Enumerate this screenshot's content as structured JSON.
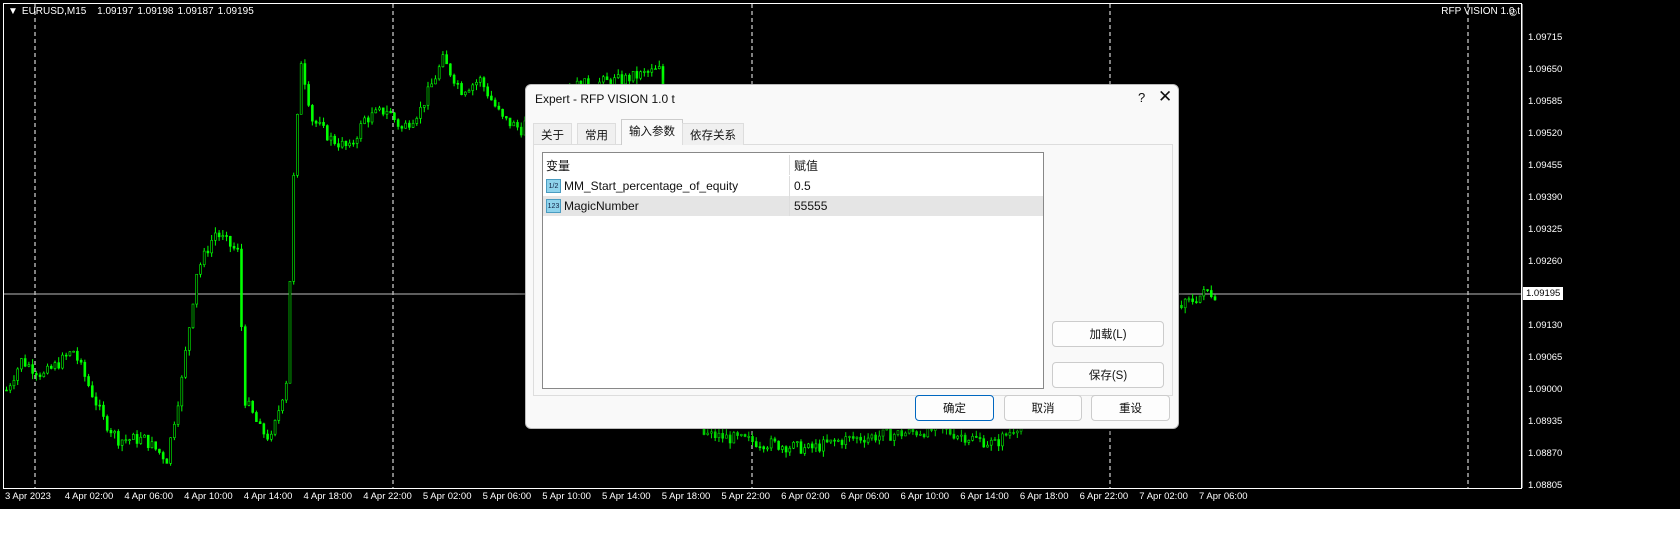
{
  "chart": {
    "symbol": "EURUSD,M15",
    "ohlc": [
      "1.09197",
      "1.09198",
      "1.09187",
      "1.09195"
    ],
    "ea_label": "RFP VISION 1.0 t",
    "current_price": "1.09195",
    "price_labels": [
      "1.09715",
      "1.09650",
      "1.09585",
      "1.09520",
      "1.09455",
      "1.09390",
      "1.09325",
      "1.09260",
      "1.09130",
      "1.09065",
      "1.09000",
      "1.08935",
      "1.08870",
      "1.08805"
    ],
    "time_labels": [
      "3 Apr 2023",
      "4 Apr 02:00",
      "4 Apr 06:00",
      "4 Apr 10:00",
      "4 Apr 14:00",
      "4 Apr 18:00",
      "4 Apr 22:00",
      "5 Apr 02:00",
      "5 Apr 06:00",
      "5 Apr 10:00",
      "5 Apr 14:00",
      "5 Apr 18:00",
      "5 Apr 22:00",
      "6 Apr 02:00",
      "6 Apr 06:00",
      "6 Apr 10:00",
      "6 Apr 14:00",
      "6 Apr 18:00",
      "6 Apr 22:00",
      "7 Apr 02:00",
      "7 Apr 06:00"
    ],
    "colors": {
      "candle": "#00ff00",
      "background": "#000000",
      "grid": "#ffffff"
    }
  },
  "chart_data": {
    "type": "candlestick",
    "title": "EURUSD,M15",
    "ylim": [
      1.08805,
      1.09715
    ],
    "price_path_keypoints": [
      [
        0,
        1.09
      ],
      [
        4,
        1.0906
      ],
      [
        10,
        1.0903
      ],
      [
        18,
        1.0908
      ],
      [
        26,
        1.0894
      ],
      [
        30,
        1.089
      ],
      [
        37,
        1.089
      ],
      [
        43,
        1.0886
      ],
      [
        47,
        1.0902
      ],
      [
        51,
        1.0924
      ],
      [
        56,
        1.0932
      ],
      [
        62,
        1.0928
      ],
      [
        64,
        1.0898
      ],
      [
        68,
        1.0892
      ],
      [
        71,
        1.089
      ],
      [
        75,
        1.0902
      ],
      [
        77,
        1.0943
      ],
      [
        79,
        1.0967
      ],
      [
        82,
        1.0955
      ],
      [
        87,
        1.0951
      ],
      [
        92,
        1.0949
      ],
      [
        96,
        1.0955
      ],
      [
        102,
        1.0957
      ],
      [
        106,
        1.0953
      ],
      [
        111,
        1.0957
      ],
      [
        117,
        1.0967
      ],
      [
        122,
        1.0961
      ],
      [
        127,
        1.0963
      ],
      [
        133,
        1.0955
      ],
      [
        138,
        1.0953
      ],
      [
        145,
        1.0961
      ],
      [
        165,
        1.0963
      ],
      [
        175,
        1.0965
      ],
      [
        187,
        1.0891
      ],
      [
        215,
        1.0888
      ],
      [
        225,
        1.089
      ],
      [
        250,
        1.0892
      ],
      [
        265,
        1.0889
      ],
      [
        290,
        1.0905
      ],
      [
        315,
        1.0917
      ],
      [
        322,
        1.092
      ],
      [
        324,
        1.09195
      ]
    ]
  },
  "dialog": {
    "title": "Expert - RFP VISION 1.0 t",
    "help": "?",
    "close": "✕",
    "tabs": [
      "关于",
      "常用",
      "输入参数",
      "依存关系"
    ],
    "columns": [
      "变量",
      "赋值"
    ],
    "params": [
      {
        "icon": "1/2",
        "name": "MM_Start_percentage_of_equity",
        "value": "0.5"
      },
      {
        "icon": "123",
        "name": "MagicNumber",
        "value": "55555"
      }
    ],
    "load": "加载(L)",
    "save": "保存(S)",
    "ok": "确定",
    "cancel": "取消",
    "reset": "重设"
  }
}
